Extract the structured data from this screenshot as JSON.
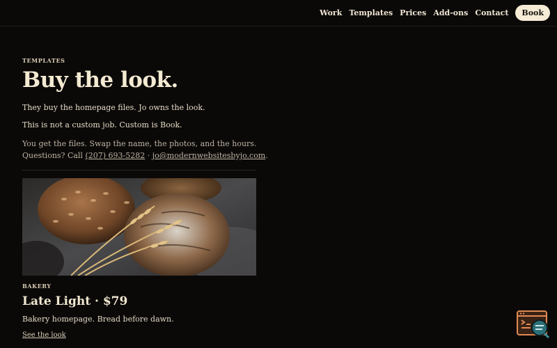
{
  "nav": {
    "items": [
      "Work",
      "Templates",
      "Prices",
      "Add-ons",
      "Contact"
    ],
    "book_label": "Book"
  },
  "intro": {
    "eyebrow": "TEMPLATES",
    "title": "Buy the look.",
    "line1": "They buy the homepage files. Jo owns the look.",
    "line2": "This is not a custom job. Custom is Book.",
    "fine_line1": "You get the files. Swap the name, the photos, and the hours.",
    "fine_questions": "Questions? Call",
    "phone": "(207) 693-5282",
    "separator": "·",
    "email": "jo@modernwebsitesbyjo.com",
    "period": "."
  },
  "card": {
    "image_icon": "bakery-bread-photo",
    "eyebrow": "BAKERY",
    "title": "Late Light · $79",
    "description": "Bakery homepage. Bread before dawn.",
    "link": "See the look"
  },
  "widget": {
    "icon": "browser-chat-icon"
  },
  "colors": {
    "background": "#0b0908",
    "text": "#ede3cf",
    "muted": "#bdb3a2",
    "book_button": "#f6ecd6",
    "widget_orange": "#e08a55",
    "widget_teal": "#3f8f9a"
  }
}
